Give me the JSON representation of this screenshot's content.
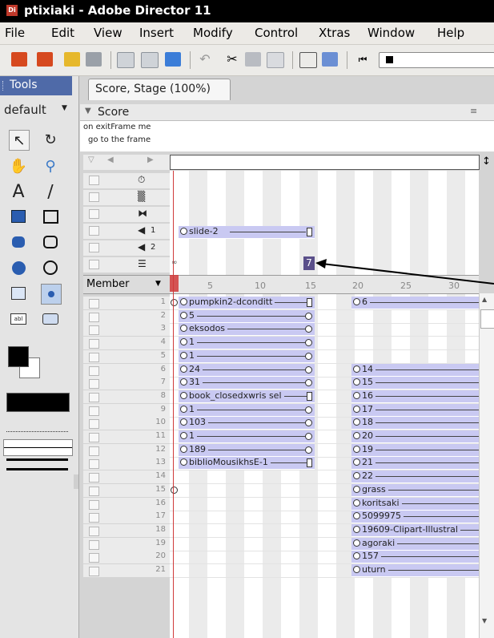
{
  "window": {
    "title": "ptixiaki - Adobe Director 11",
    "app_icon": "Di"
  },
  "menu": [
    "File",
    "Edit",
    "View",
    "Insert",
    "Modify",
    "Control",
    "Xtras",
    "Window",
    "Help"
  ],
  "tools_panel": {
    "tab_label": "Tools",
    "palette_select": "default"
  },
  "document": {
    "tab_label": "Score, Stage (100%)",
    "score_panel_label": "Score",
    "script_preview": [
      "on exitFrame me",
      "go to the frame"
    ],
    "member_column_label": "Member",
    "current_frame_marker": "7"
  },
  "special_channels": [
    {
      "icon": "tempo-icon"
    },
    {
      "icon": "palette-icon"
    },
    {
      "icon": "transition-icon"
    },
    {
      "icon": "sound-icon",
      "num": "1"
    },
    {
      "icon": "sound-icon",
      "num": "2"
    },
    {
      "icon": "script-icon"
    }
  ],
  "frame_ruler": [
    "5",
    "10",
    "15",
    "20",
    "25",
    "30"
  ],
  "sound_channel_1_sprite": "slide-2",
  "channels": [
    {
      "num": "1",
      "left": "pumpkin2-dconditt",
      "right": "6"
    },
    {
      "num": "2",
      "left": "5",
      "right": ""
    },
    {
      "num": "3",
      "left": "eksodos",
      "right": ""
    },
    {
      "num": "4",
      "left": "1",
      "right": ""
    },
    {
      "num": "5",
      "left": "1",
      "right": ""
    },
    {
      "num": "6",
      "left": "24",
      "right": "14"
    },
    {
      "num": "7",
      "left": "31",
      "right": "15"
    },
    {
      "num": "8",
      "left": "book_closedxwris sel",
      "right": "16"
    },
    {
      "num": "9",
      "left": "1",
      "right": "17"
    },
    {
      "num": "10",
      "left": "103",
      "right": "18"
    },
    {
      "num": "11",
      "left": "1",
      "right": "20"
    },
    {
      "num": "12",
      "left": "189",
      "right": "19"
    },
    {
      "num": "13",
      "left": "biblioMousikhsE-1",
      "right": "21"
    },
    {
      "num": "14",
      "left": "",
      "right": "22"
    },
    {
      "num": "15",
      "left": "",
      "right": "grass"
    },
    {
      "num": "16",
      "left": "",
      "right": "koritsaki"
    },
    {
      "num": "17",
      "left": "",
      "right": "5099975"
    },
    {
      "num": "18",
      "left": "",
      "right": "19609-Clipart-Illustral"
    },
    {
      "num": "19",
      "left": "",
      "right": "agoraki"
    },
    {
      "num": "20",
      "left": "",
      "right": "157"
    },
    {
      "num": "21",
      "left": "",
      "right": "uturn"
    }
  ],
  "colors": {
    "title_bar": "#000000",
    "tools_tab": "#4f6aa8",
    "sprite_fill": "#c9c9f2",
    "playhead": "#d03a3a",
    "marker": "#5a4f8a"
  }
}
